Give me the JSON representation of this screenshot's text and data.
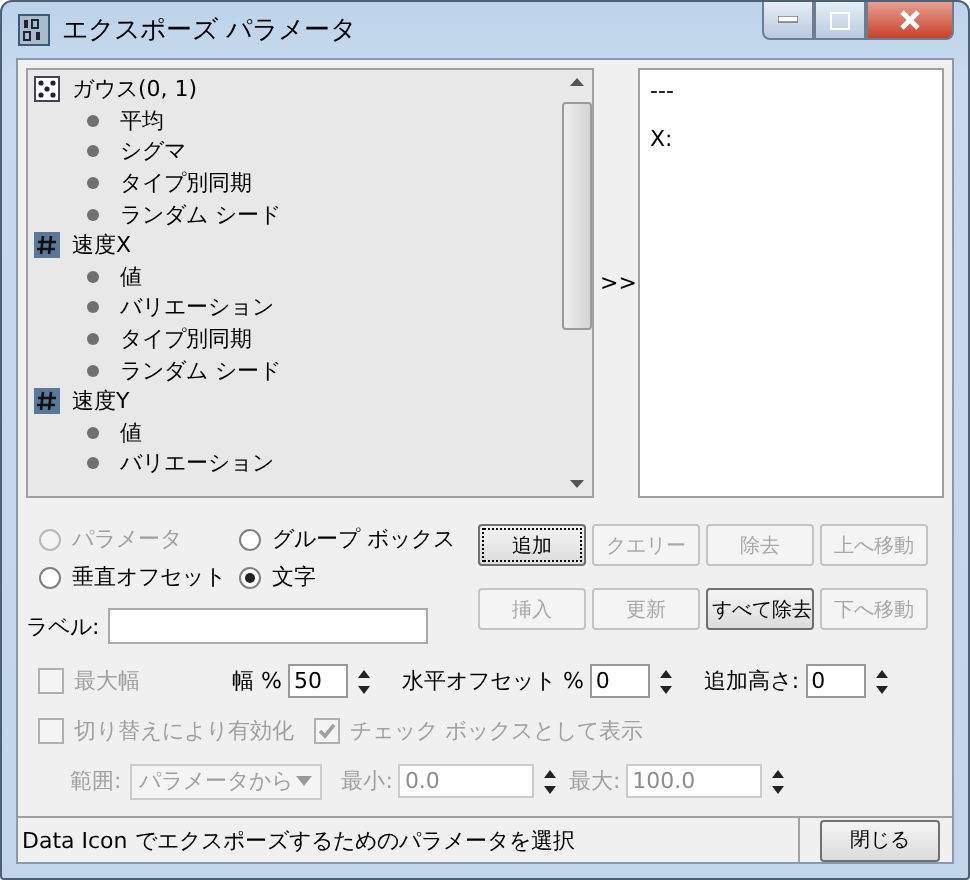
{
  "window": {
    "title": "エクスポーズ パラメータ"
  },
  "tree": [
    {
      "label": "ガウス(0, 1)",
      "kind": "dice",
      "children": [
        {
          "label": "平均"
        },
        {
          "label": "シグマ"
        },
        {
          "label": "タイプ別同期"
        },
        {
          "label": "ランダム シード"
        }
      ]
    },
    {
      "label": "速度X",
      "kind": "number",
      "children": [
        {
          "label": "値"
        },
        {
          "label": "バリエーション"
        },
        {
          "label": "タイプ別同期"
        },
        {
          "label": "ランダム シード"
        }
      ]
    },
    {
      "label": "速度Y",
      "kind": "number",
      "children": [
        {
          "label": "値"
        },
        {
          "label": "バリエーション"
        }
      ]
    }
  ],
  "transfer_button": ">>",
  "exposed_list": [
    "---",
    "X:"
  ],
  "radios": [
    {
      "label": "パラメータ",
      "selected": false,
      "disabled": true
    },
    {
      "label": "グループ ボックス",
      "selected": false,
      "disabled": false
    },
    {
      "label": "垂直オフセット",
      "selected": false,
      "disabled": false
    },
    {
      "label": "文字",
      "selected": true,
      "disabled": false
    }
  ],
  "buttons": [
    {
      "label": "追加",
      "disabled": false,
      "focused": true
    },
    {
      "label": "クエリー",
      "disabled": true,
      "focused": false
    },
    {
      "label": "除去",
      "disabled": true,
      "focused": false
    },
    {
      "label": "上へ移動",
      "disabled": true,
      "focused": false
    },
    {
      "label": "挿入",
      "disabled": true,
      "focused": false
    },
    {
      "label": "更新",
      "disabled": true,
      "focused": false
    },
    {
      "label": "すべて除去",
      "disabled": false,
      "focused": false
    },
    {
      "label": "下へ移動",
      "disabled": true,
      "focused": false
    }
  ],
  "label_field": {
    "label": "ラベル:"
  },
  "max_width": {
    "label": "最大幅",
    "checked": false,
    "disabled": true
  },
  "spinners": [
    {
      "label": "幅 %",
      "value": "50",
      "disabled": false
    },
    {
      "label": "水平オフセット %",
      "value": "0",
      "disabled": false
    },
    {
      "label": "追加高さ:",
      "value": "0",
      "disabled": false
    }
  ],
  "checkboxes": [
    {
      "label": "切り替えにより有効化",
      "checked": false,
      "disabled": true
    },
    {
      "label": "チェック ボックスとして表示",
      "checked": true,
      "disabled": true
    }
  ],
  "range": {
    "label": "範囲:",
    "value": "パラメータから",
    "disabled": true
  },
  "range_spinners": [
    {
      "label": "最小:",
      "value": "0.0",
      "disabled": true
    },
    {
      "label": "最大:",
      "value": "100.0",
      "disabled": true
    }
  ],
  "status_bar": {
    "text": "Data Icon  でエクスポーズするためのパラメータを選択"
  },
  "close_button": "閉じる"
}
